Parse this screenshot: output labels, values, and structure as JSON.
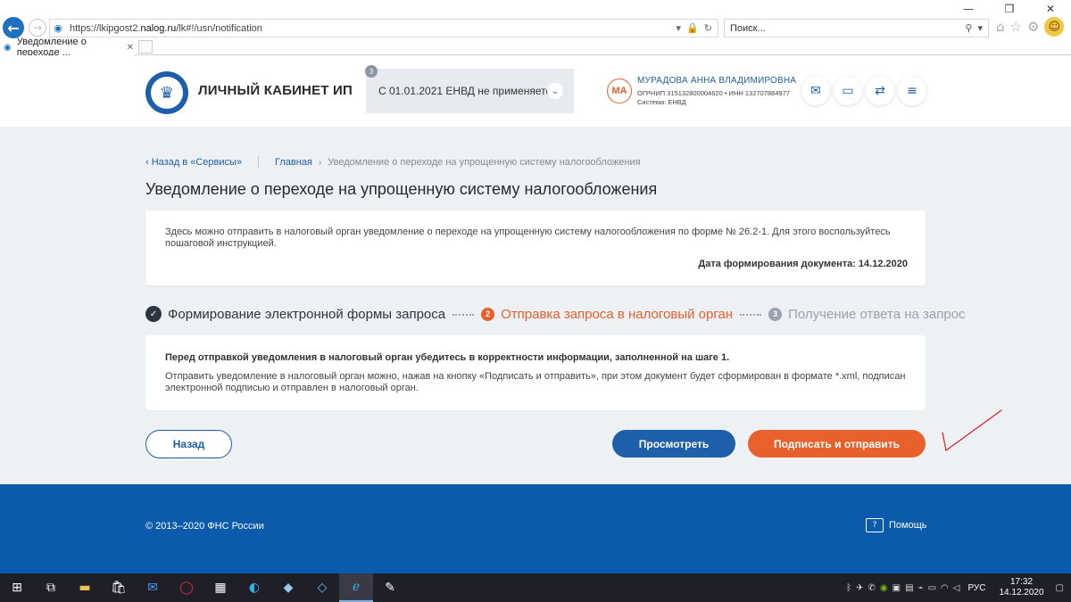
{
  "browser": {
    "url_prefix": "https://lkipgost2.",
    "url_domain": "nalog.ru",
    "url_suffix": "/lk#!/usn/notification",
    "search_placeholder": "Поиск...",
    "tab_title": "Уведомление о переходе ...",
    "window_controls": [
      "—",
      "❐",
      "✕"
    ]
  },
  "header": {
    "brand": "ЛИЧНЫЙ КАБИНЕТ ИП",
    "regime_badge": "3",
    "regime_text": "С 01.01.2021 ЕНВД не применяется",
    "avatar_initials": "МА",
    "user_name": "МУРАДОВА АННА ВЛАДИМИРОВНА",
    "user_ogrnip": "ОГРНИП 315132800004620",
    "user_inn": "ИНН 132707884977",
    "user_system": "Система: ЕНВД"
  },
  "breadcrumbs": {
    "back": "Назад в «Сервисы»",
    "home": "Главная",
    "current": "Уведомление о переходе на упрощенную систему налогообложения"
  },
  "page": {
    "title": "Уведомление о переходе на упрощенную систему налогообложения",
    "intro": "Здесь можно отправить в налоговый орган уведомление о переходе на упрощенную систему налогообложения по форме № 26.2-1. Для этого воспользуйтесь пошаговой инструкцией.",
    "date_label": "Дата формирования документа: 14.12.2020"
  },
  "steps": [
    {
      "num": "✓",
      "label": "Формирование электронной формы запроса",
      "state": "done"
    },
    {
      "num": "2",
      "label": "Отправка запроса в налоговый орган",
      "state": "active"
    },
    {
      "num": "3",
      "label": "Получение ответа на запрос",
      "state": "pending"
    }
  ],
  "notice": {
    "heading": "Перед отправкой уведомления в налоговый орган убедитесь в корректности информации, заполненной на шаге 1.",
    "body": "Отправить уведомление в налоговый орган можно, нажав на кнопку «Подписать и отправить», при этом документ будет сформирован в формате *.xml, подписан электронной подписью и отправлен в налоговый орган."
  },
  "actions": {
    "back": "Назад",
    "view": "Просмотреть",
    "sign": "Подписать и отправить"
  },
  "footer": {
    "copyright": "© 2013–2020 ФНС России",
    "help": "Помощь"
  },
  "taskbar": {
    "lang": "РУС",
    "time": "17:32",
    "date": "14.12.2020"
  },
  "colors": {
    "primary": "#1d5fa8",
    "accent": "#e8602c",
    "footer": "#0b5aab",
    "background": "#eef1f4"
  }
}
